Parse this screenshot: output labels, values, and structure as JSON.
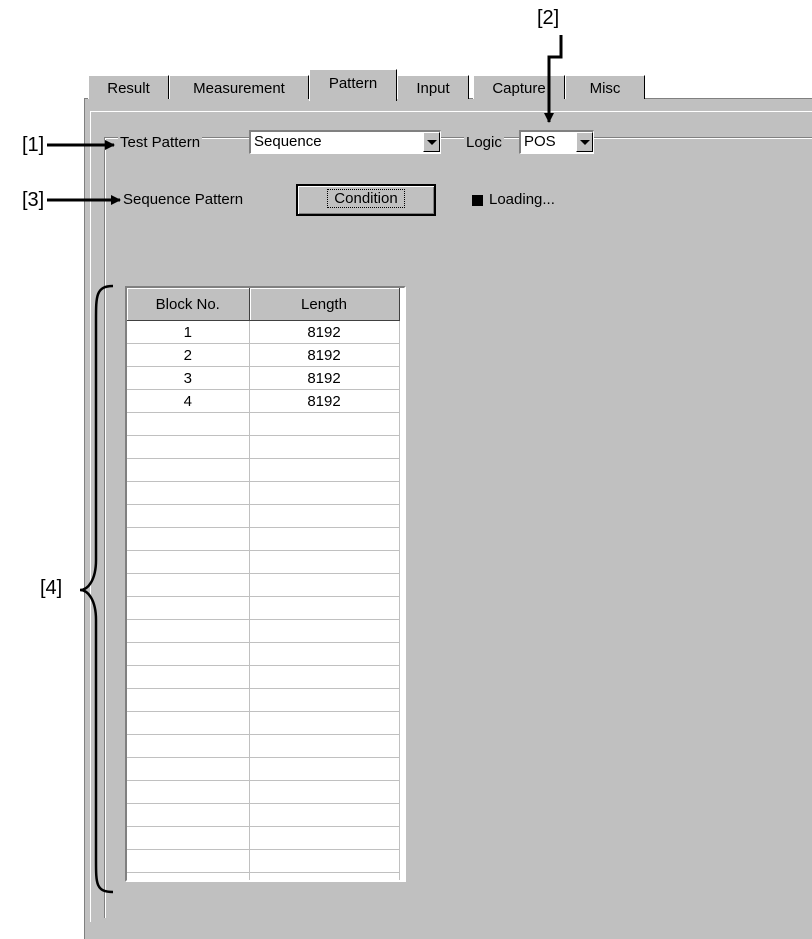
{
  "callouts": [
    "[1]",
    "[2]",
    "[3]",
    "[4]"
  ],
  "tabs": [
    "Result",
    "Measurement",
    "Pattern",
    "Input",
    "Capture",
    "Misc"
  ],
  "active_tab": "Pattern",
  "test_pattern": {
    "label": "Test Pattern",
    "value": "Sequence"
  },
  "logic": {
    "label": "Logic",
    "value": "POS"
  },
  "sequence_pattern": {
    "label": "Sequence Pattern",
    "button": "Condition",
    "status": "Loading..."
  },
  "block_table": {
    "headers": [
      "Block No.",
      "Length"
    ],
    "rows": [
      [
        "1",
        "8192"
      ],
      [
        "2",
        "8192"
      ],
      [
        "3",
        "8192"
      ],
      [
        "4",
        "8192"
      ],
      [
        "",
        ""
      ],
      [
        "",
        ""
      ],
      [
        "",
        ""
      ],
      [
        "",
        ""
      ],
      [
        "",
        ""
      ],
      [
        "",
        ""
      ],
      [
        "",
        ""
      ],
      [
        "",
        ""
      ],
      [
        "",
        ""
      ],
      [
        "",
        ""
      ],
      [
        "",
        ""
      ],
      [
        "",
        ""
      ],
      [
        "",
        ""
      ],
      [
        "",
        ""
      ],
      [
        "",
        ""
      ],
      [
        "",
        ""
      ],
      [
        "",
        ""
      ],
      [
        "",
        ""
      ],
      [
        "",
        ""
      ],
      [
        "",
        ""
      ],
      [
        "",
        ""
      ]
    ]
  }
}
